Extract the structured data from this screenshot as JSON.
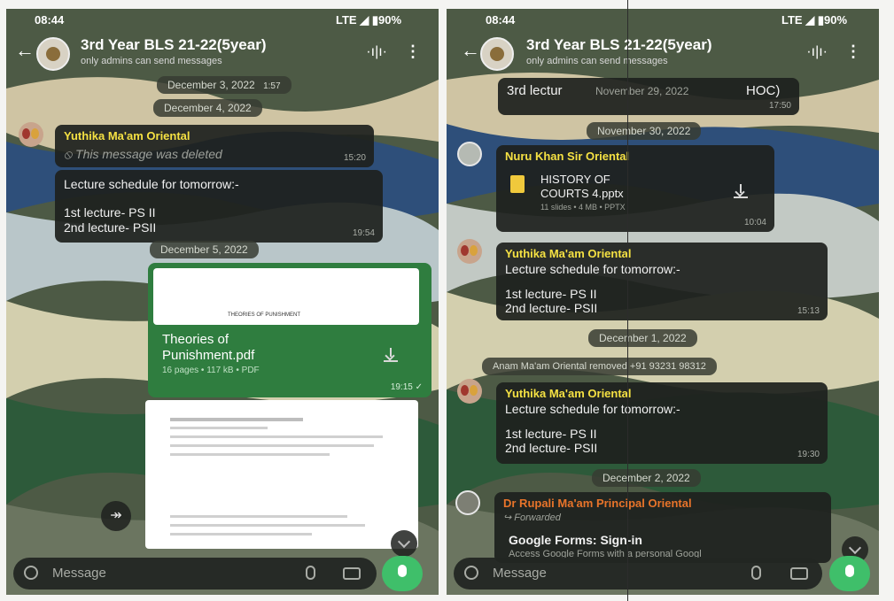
{
  "status": {
    "time": "08:44",
    "network": "LTE ◢ ▮90%"
  },
  "chat": {
    "title": "3rd Year BLS 21-22(5year)",
    "subtitle": "only admins can send messages"
  },
  "left": {
    "chip_top": "December 3, 2022",
    "chip_top_time": "1:57",
    "chip_dec4": "December 4, 2022",
    "deleted": {
      "sender": "Yuthika Ma'am Oriental",
      "text": "This message was deleted",
      "time": "15:20"
    },
    "schedule": {
      "title": "Lecture schedule for tomorrow:-",
      "line1": "1st lecture- PS II",
      "line2": "2nd lecture- PSII",
      "time": "19:54"
    },
    "chip_dec5": "December 5, 2022",
    "doc": {
      "preview_heading": "THEORIES OF PUNISHMENT",
      "name1": "Theories of",
      "name2": "Punishment.pdf",
      "meta": "16 pages • 117 kB • PDF",
      "time": "19:15 ✓"
    }
  },
  "right": {
    "prev": {
      "line": "3rd lectur",
      "overlay": "November 29, 2022",
      "suffix": "HOC)",
      "time": "17:50"
    },
    "chip_nov30": "November 30, 2022",
    "pptx": {
      "sender": "Nuru Khan Sir Oriental",
      "name1": "HISTORY OF",
      "name2": "COURTS 4.pptx",
      "meta": "11 slides • 4 MB • PPTX",
      "time": "10:04"
    },
    "msg1": {
      "sender": "Yuthika Ma'am Oriental",
      "title": "Lecture schedule for tomorrow:-",
      "line1": "1st lecture- PS II",
      "line2": "2nd lecture- PSII",
      "time": "15:13"
    },
    "chip_dec1": "December 1, 2022",
    "removed": "Anam Ma'am Oriental removed +91 93231 98312",
    "msg2": {
      "sender": "Yuthika Ma'am Oriental",
      "title": "Lecture schedule for tomorrow:-",
      "line1": "1st lecture- PS II",
      "line2": "2nd lecture- PSII",
      "time": "19:30"
    },
    "chip_dec2": "December 2, 2022",
    "forward": {
      "sender": "Dr Rupali Ma'am Principal Oriental",
      "label": "Forwarded",
      "title": "Google Forms: Sign-in",
      "desc": "Access Google Forms with a personal Googl"
    }
  },
  "input": {
    "placeholder": "Message"
  },
  "icons": [
    "back-arrow-icon",
    "voice-chat-icon",
    "more-vert-icon",
    "emoji-icon",
    "attach-icon",
    "camera-icon",
    "mic-icon",
    "forward-icon",
    "chevron-down-icon",
    "file-icon",
    "download-icon",
    "deleted-icon"
  ],
  "colors": {
    "sender_yellow": "#f5e143",
    "sender_orange": "#e8742a",
    "mic_green": "#3fbf6a",
    "doc_green": "#2f7d3f"
  }
}
